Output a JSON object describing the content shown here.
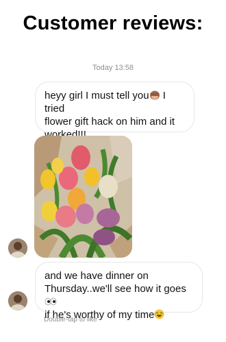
{
  "header": {
    "title": "Customer reviews:"
  },
  "chat": {
    "timestamp": "Today 13:58",
    "messages": [
      {
        "line1": "heyy girl I must tell you",
        "line1_after": " I tried",
        "line2": "flower gift hack on him and it",
        "line3": "worked!!!",
        "emoji": "see-no-evil-monkey-icon"
      },
      {
        "type": "photo",
        "subject": "tulip-bouquet-photo"
      },
      {
        "line1": "and we have dinner on",
        "line2": "Thursday..we'll see how it goes",
        "line3": "if he's worthy of my time",
        "emoji_1": "eyes-icon",
        "emoji_2": "laughing-face-icon"
      }
    ],
    "footer_hint": "Double-tap to like"
  },
  "colors": {
    "bubble_border": "#e6e6e6",
    "muted_text": "#8e8e8e"
  }
}
